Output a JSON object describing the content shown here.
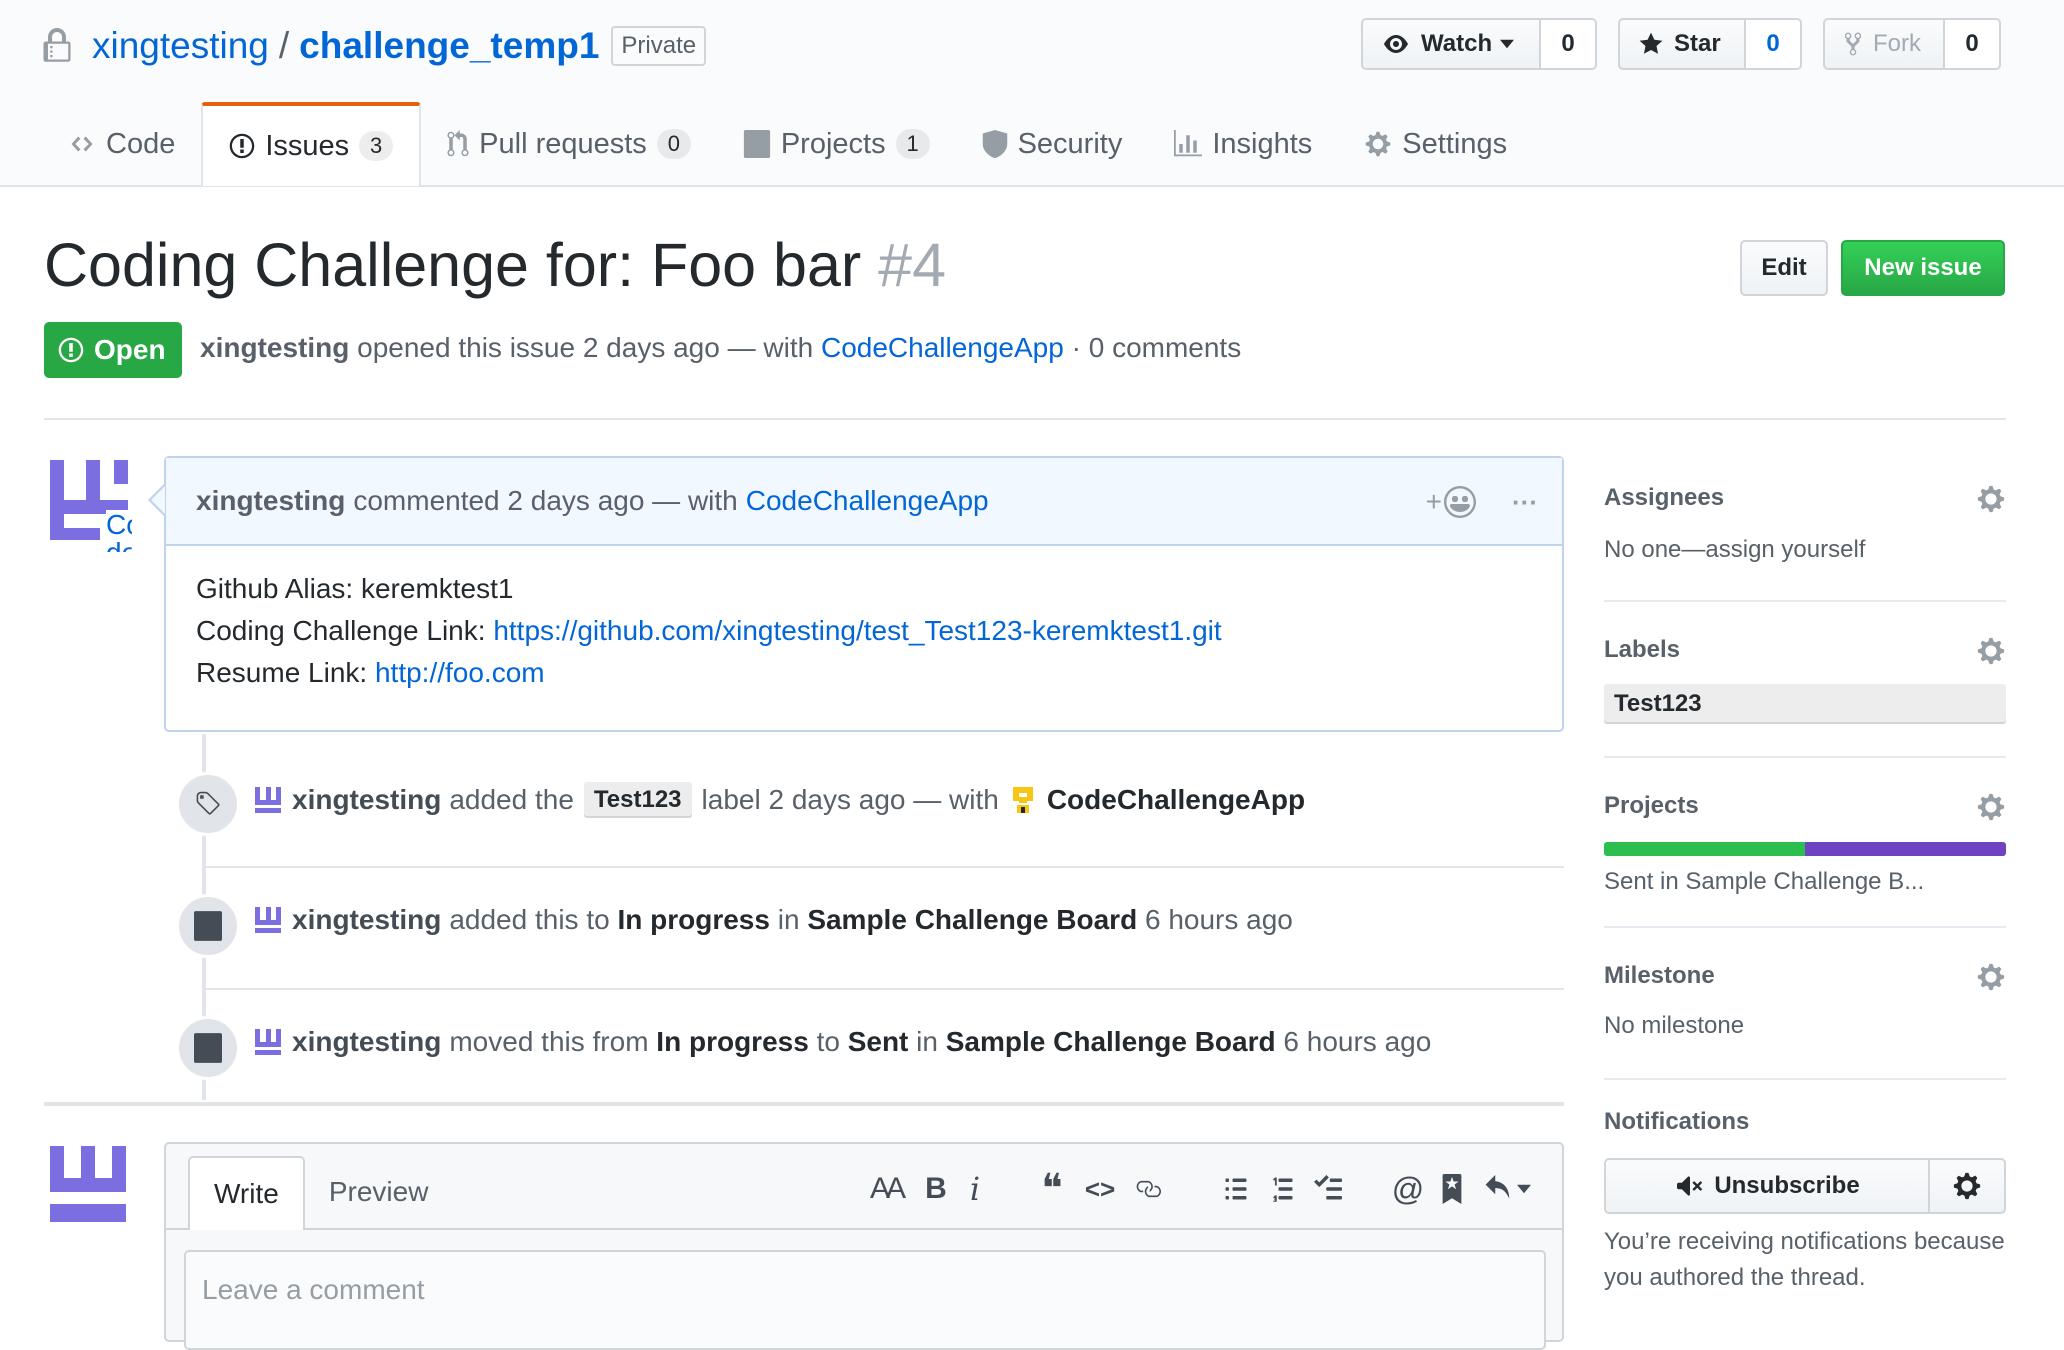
{
  "repo": {
    "owner": "xingtesting",
    "separator": "/",
    "name": "challenge_temp1",
    "visibility": "Private"
  },
  "actions": {
    "watch": {
      "label": "Watch",
      "count": "0"
    },
    "star": {
      "label": "Star",
      "count": "0"
    },
    "fork": {
      "label": "Fork",
      "count": "0"
    }
  },
  "nav": {
    "code": "Code",
    "issues": "Issues",
    "issues_count": "3",
    "pulls": "Pull requests",
    "pulls_count": "0",
    "projects": "Projects",
    "projects_count": "1",
    "security": "Security",
    "insights": "Insights",
    "settings": "Settings"
  },
  "issue": {
    "title": "Coding Challenge for: Foo bar",
    "number": "#4",
    "edit_label": "Edit",
    "new_issue_label": "New issue",
    "state": "Open",
    "author": "xingtesting",
    "meta_opened": "opened this issue 2 days ago — with",
    "app": "CodeChallengeApp",
    "meta_comments": "· 0 comments"
  },
  "comment": {
    "author": "xingtesting",
    "meta": "commented 2 days ago — with",
    "app": "CodeChallengeApp",
    "add_reaction": "+",
    "more": "···",
    "avatar_text": "Co",
    "avatar_text_2": "de",
    "line1_label": "Github Alias: keremktest1",
    "line2_label": "Coding Challenge Link: ",
    "line2_link": "https://github.com/xingtesting/test_Test123-keremktest1.git",
    "line3_label": "Resume Link: ",
    "line3_link": "http://foo.com"
  },
  "timeline": [
    {
      "author": "xingtesting",
      "pre": "added the",
      "label": "Test123",
      "post": "label 2 days ago — with",
      "app": "CodeChallengeApp"
    },
    {
      "author": "xingtesting",
      "pre": "added this to",
      "column": "In progress",
      "mid": "in",
      "board": "Sample Challenge Board",
      "time": "6 hours ago"
    },
    {
      "author": "xingtesting",
      "pre": "moved this from",
      "from": "In progress",
      "to_word": "to",
      "to": "Sent",
      "mid": "in",
      "board": "Sample Challenge Board",
      "time": "6 hours ago"
    }
  ],
  "new_comment": {
    "tab_write": "Write",
    "tab_preview": "Preview",
    "placeholder": "Leave a comment",
    "toolbar": {
      "header": "AA",
      "bold": "B",
      "italic": "i",
      "quote": "❝",
      "code": "<>",
      "link": "link-icon",
      "ul": "list-unordered-icon",
      "ol": "list-ordered-icon",
      "task": "tasklist-icon",
      "mention": "@",
      "ref": "bookmark-icon",
      "reply": "reply-icon"
    }
  },
  "sidebar": {
    "assignees": {
      "title": "Assignees",
      "value": "No one—assign yourself"
    },
    "labels": {
      "title": "Labels",
      "value": "Test123"
    },
    "projects": {
      "title": "Projects",
      "value": "Sent in Sample Challenge B...",
      "progress_done_fraction": 0.5
    },
    "milestone": {
      "title": "Milestone",
      "value": "No milestone"
    },
    "notifications": {
      "title": "Notifications",
      "button": "Unsubscribe",
      "reason": "You’re receiving notifications because you authored the thread."
    }
  },
  "colors": {
    "link": "#0366d6",
    "open_green": "#28a745",
    "nav_accent": "#e36209",
    "progress_green": "#2cbe4e",
    "progress_purple": "#6f42c1",
    "avatar_purple": "#7b6ee0"
  }
}
